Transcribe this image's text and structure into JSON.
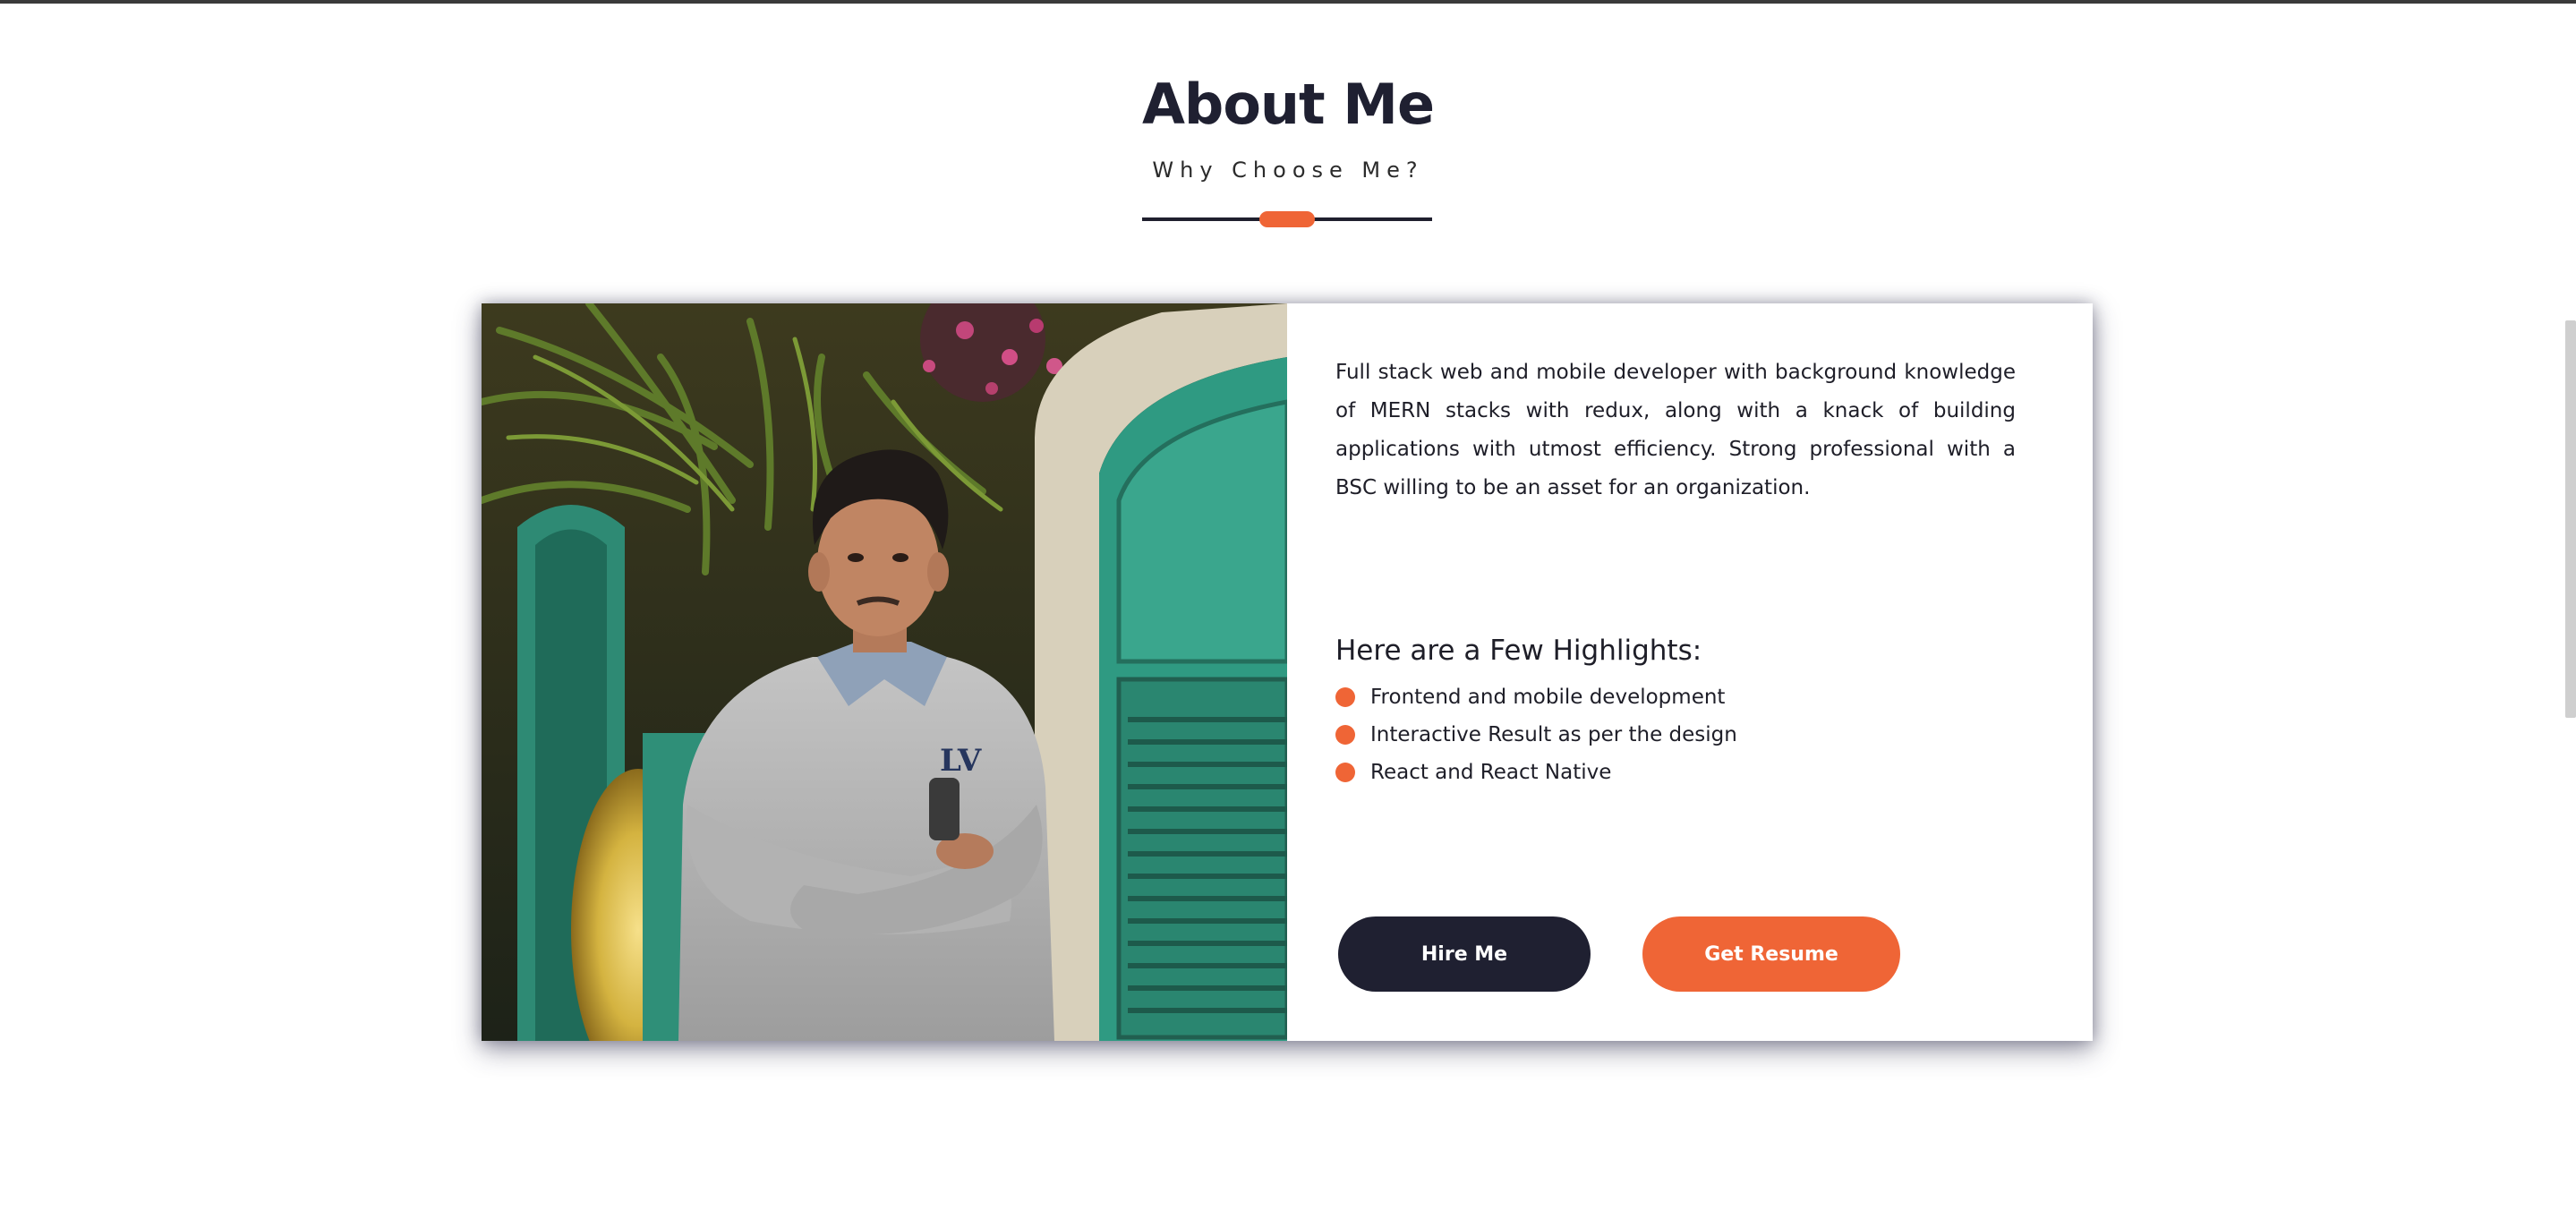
{
  "header": {
    "title": "About Me",
    "subtitle": "Why Choose Me?"
  },
  "about": {
    "photo_alt": "portrait-photo",
    "bio": "Full stack web and mobile developer with background knowledge of MERN stacks with redux, along with a knack of building applications with utmost efficiency. Strong professional with a BSC willing to be an asset for an organization.",
    "highlights_heading": "Here are a Few Highlights:",
    "highlights": [
      "Frontend and mobile development",
      "Interactive Result as per the design",
      "React and React Native"
    ],
    "buttons": {
      "hire_label": "Hire Me",
      "resume_label": "Get Resume"
    }
  },
  "colors": {
    "accent": "#ef6536",
    "dark": "#1f2031",
    "text": "#1e1e28"
  }
}
